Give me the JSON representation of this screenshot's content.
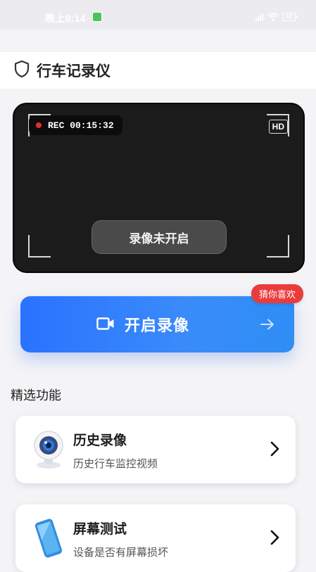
{
  "status_bar": {
    "time": "晚上8:14",
    "battery": "63"
  },
  "header": {
    "title": "行车记录仪"
  },
  "camera": {
    "rec_label": "REC 00:15:32",
    "hd_label": "HD",
    "status_text": "录像未开启"
  },
  "start_button": {
    "label": "开启录像",
    "badge": "猜你喜欢"
  },
  "section": {
    "title": "精选功能"
  },
  "features": [
    {
      "title": "历史录像",
      "subtitle": "历史行车监控视频",
      "icon": "webcam-icon"
    },
    {
      "title": "屏幕测试",
      "subtitle": "设备是否有屏幕损坏",
      "icon": "phone-icon"
    }
  ],
  "colors": {
    "accent": "#2a72ff",
    "badge": "#ea3c3c",
    "rec_dot": "#e0302c"
  }
}
